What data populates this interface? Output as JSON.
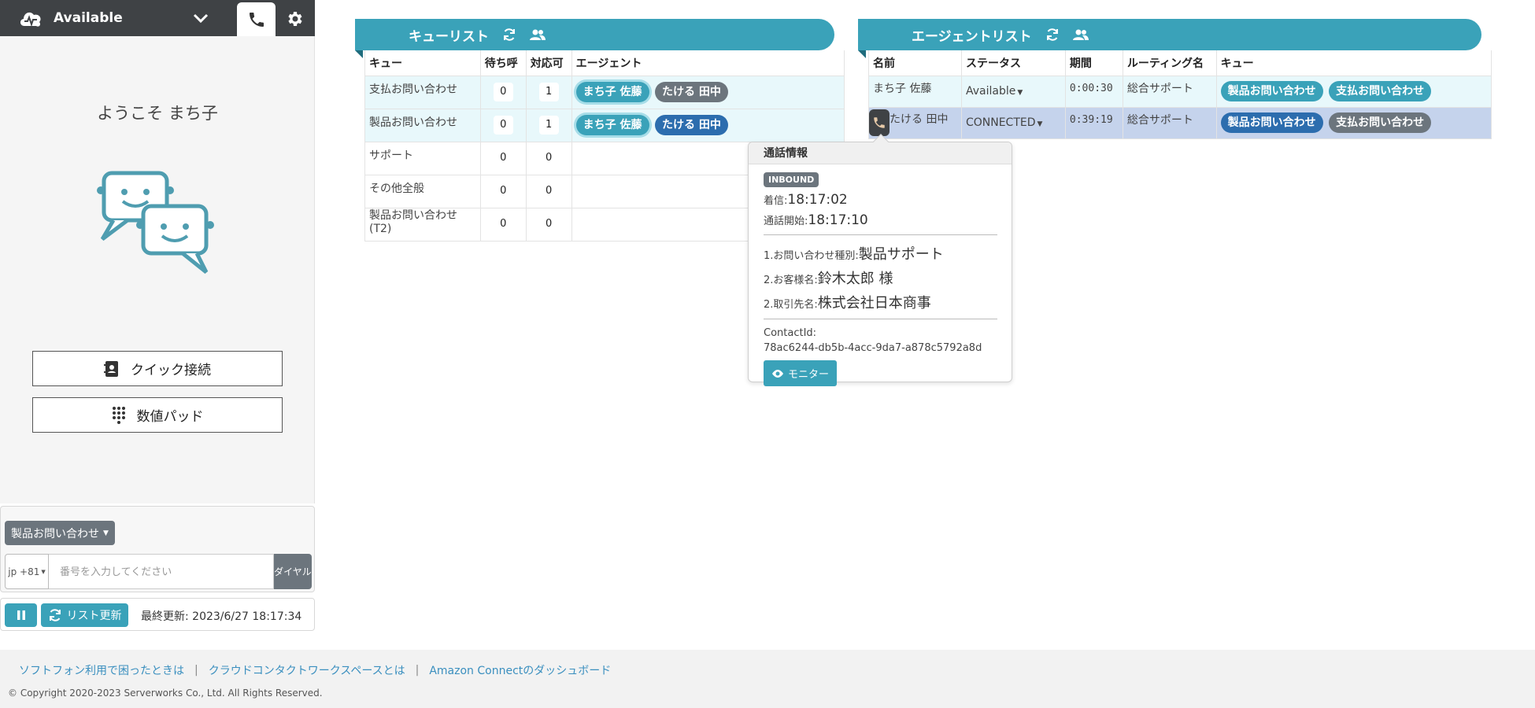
{
  "softphone": {
    "status_label": "Available",
    "welcome": "ようこそ まち子",
    "quick_connect_label": "クイック接続",
    "numpad_label": "数値パッド",
    "queue_select_label": "製品お問い合わせ",
    "country_label": "jp +81",
    "phone_placeholder": "番号を入力してください",
    "dial_label": "ダイヤル",
    "refresh_label": "リスト更新",
    "last_updated": "最終更新: 2023/6/27 18:17:34"
  },
  "queue_list": {
    "title": "キューリスト",
    "columns": [
      "キュー",
      "待ち呼",
      "対応可",
      "エージェント"
    ],
    "rows": [
      {
        "name": "支払お問い合わせ",
        "waiting": "0",
        "available": "1",
        "agents": [
          "まち子 佐藤",
          "たける 田中"
        ]
      },
      {
        "name": "製品お問い合わせ",
        "waiting": "0",
        "available": "1",
        "agents": [
          "まち子 佐藤",
          "たける 田中"
        ]
      },
      {
        "name": "サポート",
        "waiting": "0",
        "available": "0",
        "agents": []
      },
      {
        "name": "その他全般",
        "waiting": "0",
        "available": "0",
        "agents": []
      },
      {
        "name": "製品お問い合わせ(T2)",
        "waiting": "0",
        "available": "0",
        "agents": []
      }
    ]
  },
  "agent_list": {
    "title": "エージェントリスト",
    "columns": [
      "名前",
      "ステータス",
      "期間",
      "ルーティング名",
      "キュー"
    ],
    "rows": [
      {
        "name": "まち子 佐藤",
        "status": "Available",
        "duration": "0:00:30",
        "routing": "総合サポート",
        "queues": [
          "製品お問い合わせ",
          "支払お問い合わせ"
        ]
      },
      {
        "name": "たける 田中",
        "status": "CONNECTED",
        "duration": "0:39:19",
        "routing": "総合サポート",
        "queues": [
          "製品お問い合わせ",
          "支払お問い合わせ"
        ]
      }
    ]
  },
  "call_info": {
    "title": "通話情報",
    "direction": "INBOUND",
    "incoming_label": "着信:",
    "incoming_time": "18:17:02",
    "start_label": "通話開始:",
    "start_time": "18:17:10",
    "field1_label": "1.お問い合わせ種別:",
    "field1_value": "製品サポート",
    "field2_label": "2.お客様名:",
    "field2_value": "鈴木太郎 様",
    "field3_label": "2.取引先名:",
    "field3_value": "株式会社日本商事",
    "contact_id_label": "ContactId:",
    "contact_id": "78ac6244-db5b-4acc-9da7-a878c5792a8d",
    "monitor_label": "モニター"
  },
  "footer": {
    "link1": "ソフトフォン利用で困ったときは",
    "link2": "クラウドコンタクトワークスペースとは",
    "link3": "Amazon Connectのダッシュボード",
    "separator": "|",
    "copyright": "© Copyright 2020-2023 Serverworks Co., Ltd. All Rights Reserved."
  },
  "colors": {
    "accent": "#3aa2b9",
    "header_dark": "#3f4245",
    "pill_gray": "#6c757d",
    "pill_blue": "#2c6dae",
    "row_highlight": "#e8f8fb",
    "row_selected": "#c5d3ec"
  },
  "icons": [
    "cloud-status-icon",
    "chevron-down-icon",
    "phone-icon",
    "gear-icon",
    "refresh-icon",
    "users-icon",
    "contact-book-icon",
    "keypad-icon",
    "pause-icon",
    "eye-icon",
    "call-active-icon"
  ]
}
